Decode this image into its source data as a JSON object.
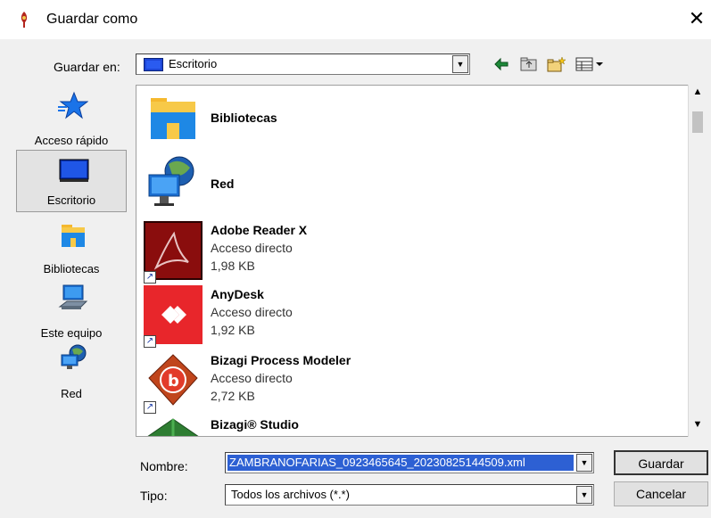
{
  "window": {
    "title": "Guardar como",
    "close_label": "✕"
  },
  "save_in": {
    "label": "Guardar en:",
    "value": "Escritorio"
  },
  "toolbar": {
    "back_icon": "back-arrow-icon",
    "up_folder_icon": "up-folder-icon",
    "new_folder_icon": "new-folder-icon",
    "view_menu_icon": "view-menu-icon"
  },
  "places": [
    {
      "label": "Acceso rápido",
      "icon": "star-icon"
    },
    {
      "label": "Escritorio",
      "icon": "desktop-icon",
      "selected": true
    },
    {
      "label": "Bibliotecas",
      "icon": "library-icon"
    },
    {
      "label": "Este equipo",
      "icon": "computer-icon"
    },
    {
      "label": "Red",
      "icon": "network-icon"
    }
  ],
  "files": [
    {
      "name": "Bibliotecas",
      "type": "",
      "size": "",
      "icon": "library-folder-icon"
    },
    {
      "name": "Red",
      "type": "",
      "size": "",
      "icon": "network-globe-icon"
    },
    {
      "name": "Adobe Reader X",
      "type": "Acceso directo",
      "size": "1,98 KB",
      "icon": "adobe-reader-icon"
    },
    {
      "name": "AnyDesk",
      "type": "Acceso directo",
      "size": "1,92 KB",
      "icon": "anydesk-icon"
    },
    {
      "name": "Bizagi Process Modeler",
      "type": "Acceso directo",
      "size": "2,72 KB",
      "icon": "bizagi-icon"
    },
    {
      "name": "Bizagi® Studio",
      "type": "",
      "size": "",
      "icon": "bizagi-studio-icon"
    }
  ],
  "filename": {
    "label": "Nombre:",
    "value": "ZAMBRANOFARIAS_0923465645_20230825144509.xml"
  },
  "filetype": {
    "label": "Tipo:",
    "value": "Todos los archivos (*.*)"
  },
  "buttons": {
    "save": "Guardar",
    "cancel": "Cancelar"
  },
  "scroll": {
    "up": "^",
    "down": "v"
  }
}
